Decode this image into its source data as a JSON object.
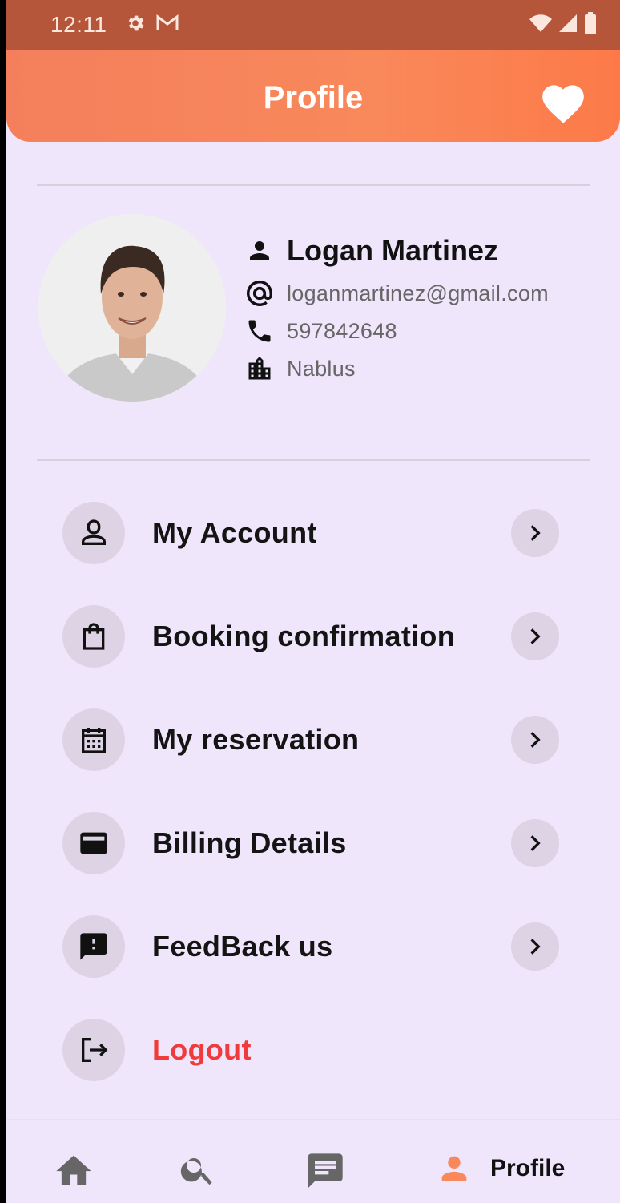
{
  "status_bar": {
    "time": "12:11",
    "icons": [
      "gear-icon",
      "gmail-icon",
      "wifi-icon",
      "signal-icon",
      "battery-icon"
    ]
  },
  "app_bar": {
    "title": "Profile",
    "action_icon": "heart-icon"
  },
  "profile": {
    "name": "Logan Martinez",
    "email": "loganmartinez@gmail.com",
    "phone": "597842648",
    "city": "Nablus"
  },
  "menu": {
    "items": [
      {
        "label": "My Account",
        "icon": "account-icon"
      },
      {
        "label": "Booking confirmation",
        "icon": "shopping-bag-icon"
      },
      {
        "label": "My reservation",
        "icon": "calendar-icon"
      },
      {
        "label": "Billing Details",
        "icon": "wallet-icon"
      },
      {
        "label": "FeedBack us",
        "icon": "feedback-icon"
      }
    ],
    "logout_label": "Logout"
  },
  "bottom_nav": {
    "items": [
      "home-icon",
      "search-icon",
      "chat-icon",
      "profile-icon"
    ],
    "active_label": "Profile"
  },
  "colors": {
    "accent": "#f9885b",
    "background": "#f0e6fc",
    "logout": "#ef3b3b",
    "icon_bg": "#ddd3e5",
    "status_bar": "#b5553a"
  }
}
